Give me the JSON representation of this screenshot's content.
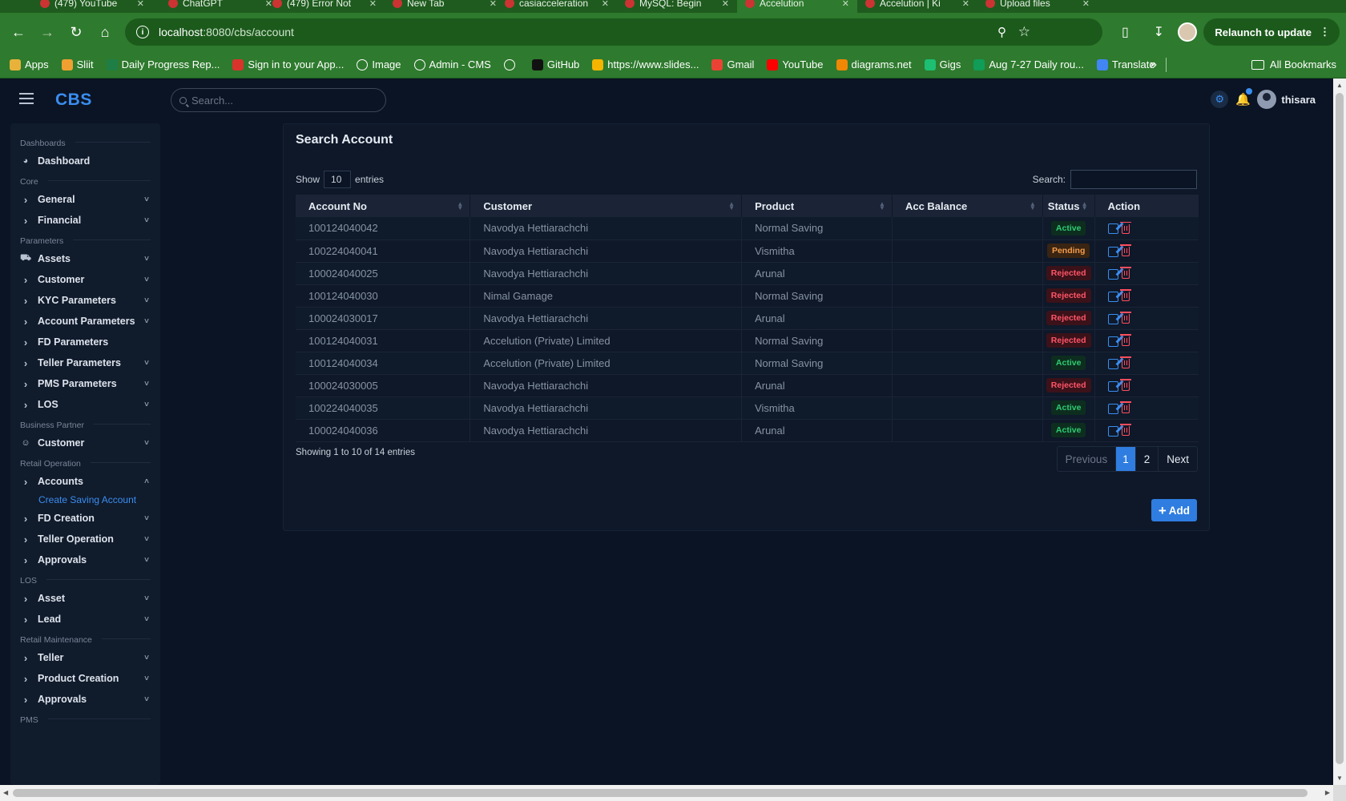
{
  "browser": {
    "tabs": [
      {
        "label": "(479) YouTube"
      },
      {
        "label": "ChatGPT"
      },
      {
        "label": "(479) Error Not"
      },
      {
        "label": "New Tab"
      },
      {
        "label": "casiacceleration"
      },
      {
        "label": "MySQL: Begin"
      },
      {
        "label": "Accelution",
        "active": true
      },
      {
        "label": "Accelution | Ki"
      },
      {
        "label": "Upload files"
      }
    ],
    "url_host": "localhost",
    "url_path": ":8080/cbs/account",
    "relaunch_label": "Relaunch to update",
    "bookmarks": [
      {
        "label": "Apps",
        "icon": "apps-grid-icon",
        "color": "#e8b23a"
      },
      {
        "label": "Sliit",
        "icon": "sliit-icon",
        "color": "#f0a030"
      },
      {
        "label": "Daily Progress Rep...",
        "icon": "excel-icon",
        "color": "#1e7e45"
      },
      {
        "label": "Sign in to your App...",
        "icon": "app-icon",
        "color": "#d9342b"
      },
      {
        "label": "Image",
        "icon": "globe-icon",
        "color": "#ffffff"
      },
      {
        "label": "Admin - CMS",
        "icon": "globe-icon",
        "color": "#ffffff"
      },
      {
        "label": "",
        "icon": "globe-icon",
        "color": "#ffffff"
      },
      {
        "label": "GitHub",
        "icon": "github-icon",
        "color": "#111111"
      },
      {
        "label": "https://www.slides...",
        "icon": "slides-icon",
        "color": "#f4b400"
      },
      {
        "label": "Gmail",
        "icon": "gmail-icon",
        "color": "#ea4335"
      },
      {
        "label": "YouTube",
        "icon": "youtube-icon",
        "color": "#ff0000"
      },
      {
        "label": "diagrams.net",
        "icon": "drawio-icon",
        "color": "#f08705"
      },
      {
        "label": "Gigs",
        "icon": "fiverr-icon",
        "color": "#1dbf73"
      },
      {
        "label": "Aug 7-27 Daily rou...",
        "icon": "sheets-icon",
        "color": "#0f9d58"
      },
      {
        "label": "Translate",
        "icon": "translate-icon",
        "color": "#4285f4"
      }
    ],
    "all_bookmarks_label": "All Bookmarks"
  },
  "app": {
    "brand": "CBS",
    "search_placeholder": "Search...",
    "username": "thisara",
    "accent": "#2f7de0"
  },
  "sidebar": {
    "groups": [
      {
        "heading": "Dashboards",
        "items": [
          {
            "label": "Dashboard",
            "icon": "dashboard-icon",
            "type": "icon"
          }
        ]
      },
      {
        "heading": "Core",
        "items": [
          {
            "label": "General",
            "type": "expand"
          },
          {
            "label": "Financial",
            "type": "expand"
          }
        ]
      },
      {
        "heading": "Parameters",
        "items": [
          {
            "label": "Assets",
            "icon": "car-icon",
            "type": "icon"
          },
          {
            "label": "Customer",
            "type": "expand"
          },
          {
            "label": "KYC Parameters",
            "type": "expand"
          },
          {
            "label": "Account Parameters",
            "type": "expand"
          },
          {
            "label": "FD Parameters",
            "type": "expand-noarrow"
          },
          {
            "label": "Teller Parameters",
            "type": "expand"
          },
          {
            "label": "PMS Parameters",
            "type": "expand"
          },
          {
            "label": "LOS",
            "type": "expand"
          }
        ]
      },
      {
        "heading": "Business Partner",
        "items": [
          {
            "label": "Customer",
            "icon": "user-icon",
            "type": "icon"
          }
        ]
      },
      {
        "heading": "Retail Operation",
        "items": [
          {
            "label": "Accounts",
            "type": "expand-open",
            "sub": [
              "Create Saving Account"
            ]
          },
          {
            "label": "FD Creation",
            "type": "expand"
          },
          {
            "label": "Teller Operation",
            "type": "expand"
          },
          {
            "label": "Approvals",
            "type": "expand"
          }
        ]
      },
      {
        "heading": "LOS",
        "items": [
          {
            "label": "Asset",
            "type": "expand"
          },
          {
            "label": "Lead",
            "type": "expand"
          }
        ]
      },
      {
        "heading": "Retail Maintenance",
        "items": [
          {
            "label": "Teller",
            "type": "expand"
          },
          {
            "label": "Product Creation",
            "type": "expand"
          },
          {
            "label": "Approvals",
            "type": "expand"
          }
        ]
      },
      {
        "heading": "PMS",
        "items": []
      }
    ]
  },
  "main": {
    "title": "Search Account",
    "show_label": "Show",
    "page_length": "10",
    "entries_label": "entries",
    "search_label": "Search:",
    "columns": [
      "Account No",
      "Customer",
      "Product",
      "Acc Balance",
      "Status",
      "Action"
    ],
    "rows": [
      {
        "account_no": "100124040042",
        "customer": "Navodya Hettiarachchi",
        "product": "Normal Saving",
        "balance": "",
        "status": "Active"
      },
      {
        "account_no": "100224040041",
        "customer": "Navodya Hettiarachchi",
        "product": "Vismitha",
        "balance": "",
        "status": "Pending"
      },
      {
        "account_no": "100024040025",
        "customer": "Navodya Hettiarachchi",
        "product": "Arunal",
        "balance": "",
        "status": "Rejected"
      },
      {
        "account_no": "100124040030",
        "customer": "Nimal Gamage",
        "product": "Normal Saving",
        "balance": "",
        "status": "Rejected"
      },
      {
        "account_no": "100024030017",
        "customer": "Navodya Hettiarachchi",
        "product": "Arunal",
        "balance": "",
        "status": "Rejected"
      },
      {
        "account_no": "100124040031",
        "customer": "Accelution (Private) Limited",
        "product": "Normal Saving",
        "balance": "",
        "status": "Rejected"
      },
      {
        "account_no": "100124040034",
        "customer": "Accelution (Private) Limited",
        "product": "Normal Saving",
        "balance": "",
        "status": "Active"
      },
      {
        "account_no": "100024030005",
        "customer": "Navodya Hettiarachchi",
        "product": "Arunal",
        "balance": "",
        "status": "Rejected"
      },
      {
        "account_no": "100224040035",
        "customer": "Navodya Hettiarachchi",
        "product": "Vismitha",
        "balance": "",
        "status": "Active"
      },
      {
        "account_no": "100024040036",
        "customer": "Navodya Hettiarachchi",
        "product": "Arunal",
        "balance": "",
        "status": "Active"
      }
    ],
    "info": "Showing 1 to 10 of 14 entries",
    "pager": {
      "previous": "Previous",
      "pages": [
        "1",
        "2"
      ],
      "current": "1",
      "next": "Next"
    },
    "add_label": "Add"
  }
}
